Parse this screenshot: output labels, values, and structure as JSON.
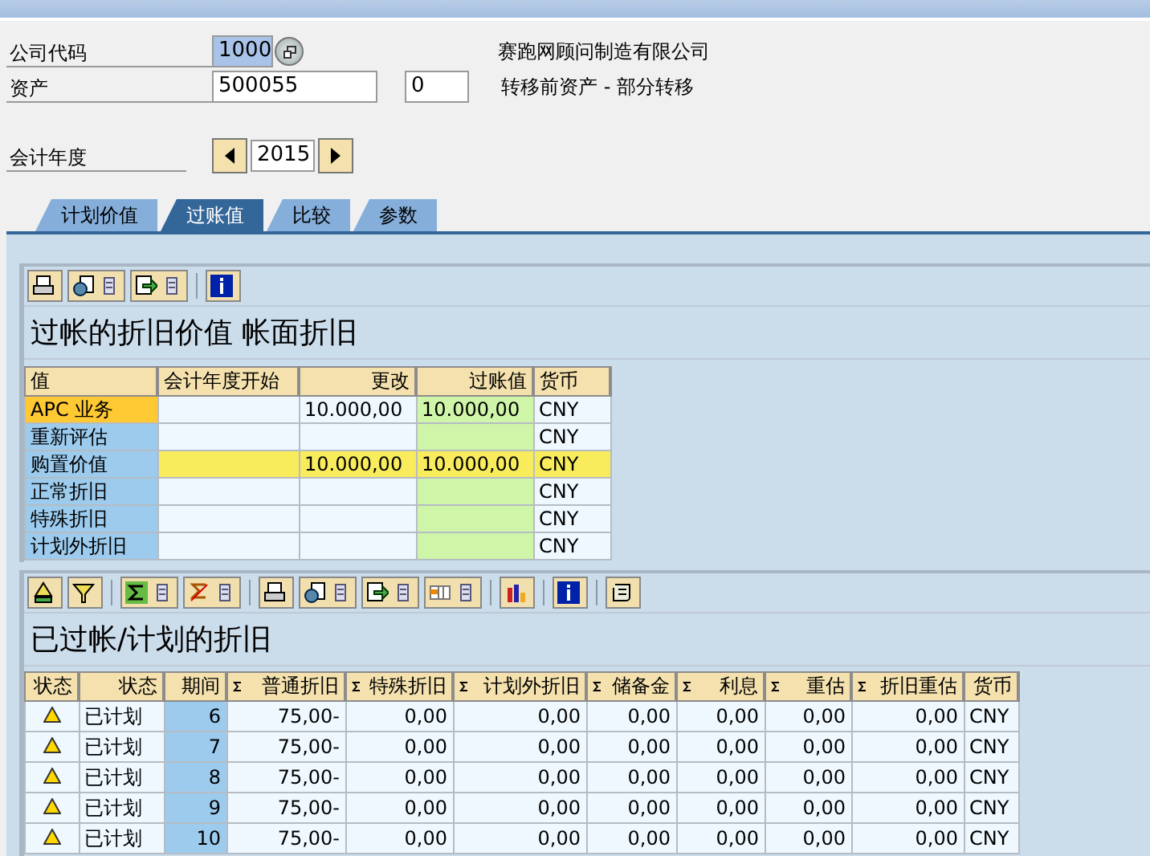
{
  "form": {
    "company_code": {
      "label": "公司代码",
      "value": "1000",
      "description": "赛跑网顾问制造有限公司"
    },
    "asset": {
      "label": "资产",
      "value": "500055",
      "sub_value": "0",
      "description": "转移前资产 - 部分转移"
    },
    "fiscal_year": {
      "label": "会计年度",
      "value": "2015"
    }
  },
  "tabs": [
    {
      "label": "计划价值",
      "selected": false
    },
    {
      "label": "过账值",
      "selected": true
    },
    {
      "label": "比较",
      "selected": false
    },
    {
      "label": "参数",
      "selected": false
    }
  ],
  "posted_grid": {
    "title": "过帐的折旧价值 帐面折旧",
    "columns": [
      "值",
      "会计年度开始",
      "更改",
      "过账值",
      "货币"
    ],
    "rows": [
      {
        "kind": "normal",
        "selected": true,
        "cells": [
          "APC 业务",
          "",
          "10.000,00",
          "10.000,00",
          "CNY"
        ]
      },
      {
        "kind": "normal",
        "selected": false,
        "cells": [
          "重新评估",
          "",
          "",
          "",
          "CNY"
        ]
      },
      {
        "kind": "total",
        "selected": false,
        "cells": [
          "购置价值",
          "",
          "10.000,00",
          "10.000,00",
          "CNY"
        ]
      },
      {
        "kind": "normal",
        "selected": false,
        "cells": [
          "正常折旧",
          "",
          "",
          "",
          "CNY"
        ]
      },
      {
        "kind": "normal",
        "selected": false,
        "cells": [
          "特殊折旧",
          "",
          "",
          "",
          "CNY"
        ]
      },
      {
        "kind": "normal",
        "selected": false,
        "cells": [
          "计划外折旧",
          "",
          "",
          "",
          "CNY"
        ]
      }
    ]
  },
  "depreciation_grid": {
    "title": "已过帐/计划的折旧",
    "columns": [
      {
        "label": "状态",
        "totals": false
      },
      {
        "label": "状态",
        "totals": false
      },
      {
        "label": "期间",
        "totals": false
      },
      {
        "label": "普通折旧",
        "totals": true
      },
      {
        "label": "特殊折旧",
        "totals": true
      },
      {
        "label": "计划外折旧",
        "totals": true
      },
      {
        "label": "储备金",
        "totals": true
      },
      {
        "label": "利息",
        "totals": true
      },
      {
        "label": "重估",
        "totals": true
      },
      {
        "label": "折旧重估",
        "totals": true
      },
      {
        "label": "货币",
        "totals": false
      }
    ],
    "rows": [
      {
        "kind": "warning",
        "cells": [
          "",
          "已计划",
          "6",
          "75,00-",
          "0,00",
          "0,00",
          "0,00",
          "0,00",
          "0,00",
          "0,00",
          "CNY"
        ]
      },
      {
        "kind": "warning",
        "cells": [
          "",
          "已计划",
          "7",
          "75,00-",
          "0,00",
          "0,00",
          "0,00",
          "0,00",
          "0,00",
          "0,00",
          "CNY"
        ]
      },
      {
        "kind": "warning",
        "cells": [
          "",
          "已计划",
          "8",
          "75,00-",
          "0,00",
          "0,00",
          "0,00",
          "0,00",
          "0,00",
          "0,00",
          "CNY"
        ]
      },
      {
        "kind": "warning",
        "cells": [
          "",
          "已计划",
          "9",
          "75,00-",
          "0,00",
          "0,00",
          "0,00",
          "0,00",
          "0,00",
          "0,00",
          "CNY"
        ]
      },
      {
        "kind": "warning",
        "cells": [
          "",
          "已计划",
          "10",
          "75,00-",
          "0,00",
          "0,00",
          "0,00",
          "0,00",
          "0,00",
          "0,00",
          "CNY"
        ]
      }
    ]
  }
}
